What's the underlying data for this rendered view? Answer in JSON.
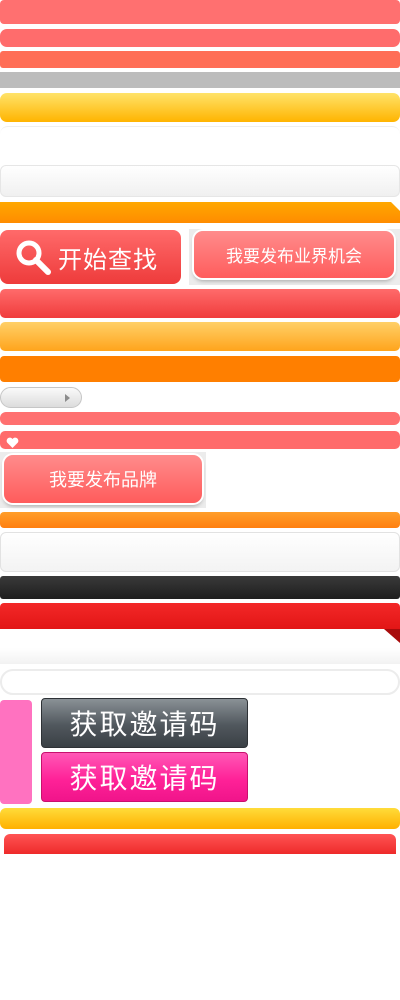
{
  "search_button": {
    "label": "开始查找",
    "icon": "search-icon"
  },
  "publish_opportunity_button": {
    "label": "我要发布业界机会"
  },
  "publish_brand_button": {
    "label": "我要发布品牌"
  },
  "gray_pill": {
    "icon": "play-triangle-icon"
  },
  "heart_bar": {
    "icon": "heart-icon"
  },
  "invite_dark_button": {
    "label": "获取邀请码"
  },
  "invite_pink_button": {
    "label": "获取邀请码"
  },
  "colors": {
    "coral": "#ff6f6f",
    "orange": "#ff8800",
    "amber": "#ffc000",
    "red": "#e81818",
    "pink": "#ff6fbc",
    "magenta": "#ff2298",
    "slate": "#4b5055",
    "gray": "#bdbdbd"
  }
}
